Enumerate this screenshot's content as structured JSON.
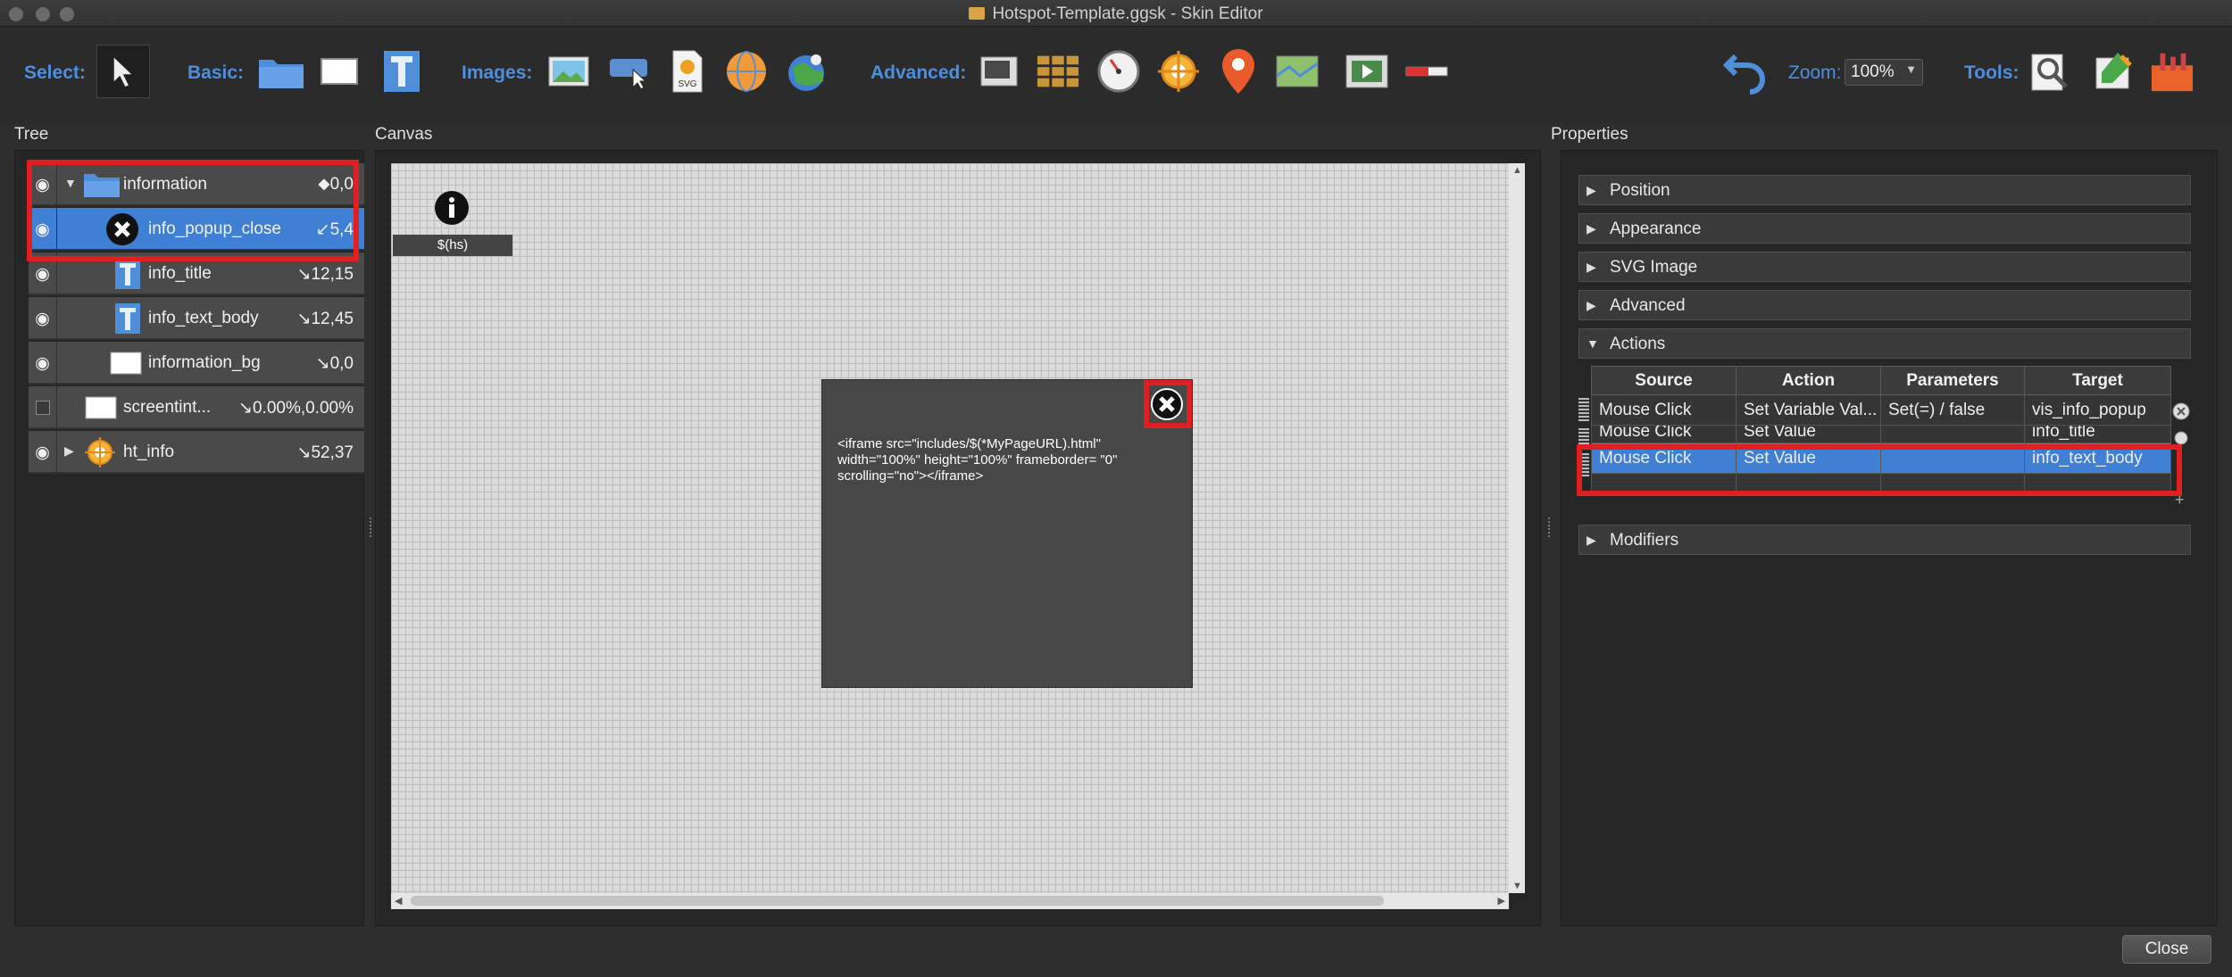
{
  "window": {
    "title": "Hotspot-Template.ggsk - Skin Editor"
  },
  "toolbar": {
    "select_label": "Select:",
    "basic_label": "Basic:",
    "images_label": "Images:",
    "advanced_label": "Advanced:",
    "zoom_label": "Zoom:",
    "zoom_value": "100%",
    "tools_label": "Tools:",
    "svg_badge": "SVG"
  },
  "panels": {
    "tree": "Tree",
    "canvas": "Canvas",
    "properties": "Properties"
  },
  "tree": {
    "items": [
      {
        "name": "information",
        "coord": "⬥0,0"
      },
      {
        "name": "info_popup_close",
        "coord": "↙5,4"
      },
      {
        "name": "info_title",
        "coord": "↘12,15"
      },
      {
        "name": "info_text_body",
        "coord": "↘12,45"
      },
      {
        "name": "information_bg",
        "coord": "↘0,0"
      },
      {
        "name": "screentint...",
        "coord": "↘0.00%,0.00%"
      },
      {
        "name": "ht_info",
        "coord": "↘52,37"
      }
    ]
  },
  "canvas": {
    "hs_label": "$(hs)",
    "iframe_text_1": "<iframe src=\"includes/$(*MyPageURL).html\"",
    "iframe_text_2": "width=\"100%\" height=\"100%\" frameborder= \"0\"",
    "iframe_text_3": "scrolling=\"no\"></iframe>"
  },
  "properties": {
    "sections": [
      "Position",
      "Appearance",
      "SVG Image",
      "Advanced",
      "Actions",
      "Modifiers"
    ],
    "actions": {
      "headers": [
        "Source",
        "Action",
        "Parameters",
        "Target"
      ],
      "rows": [
        {
          "source": "Mouse Click",
          "action": "Set Variable Val...",
          "params": "Set(=) / false",
          "target": "vis_info_popup"
        },
        {
          "source": "Mouse Click",
          "action": "Set Value",
          "params": "",
          "target": "info_title"
        },
        {
          "source": "Mouse Click",
          "action": "Set Value",
          "params": "",
          "target": "info_text_body"
        }
      ]
    }
  },
  "footer": {
    "close_label": "Close"
  }
}
